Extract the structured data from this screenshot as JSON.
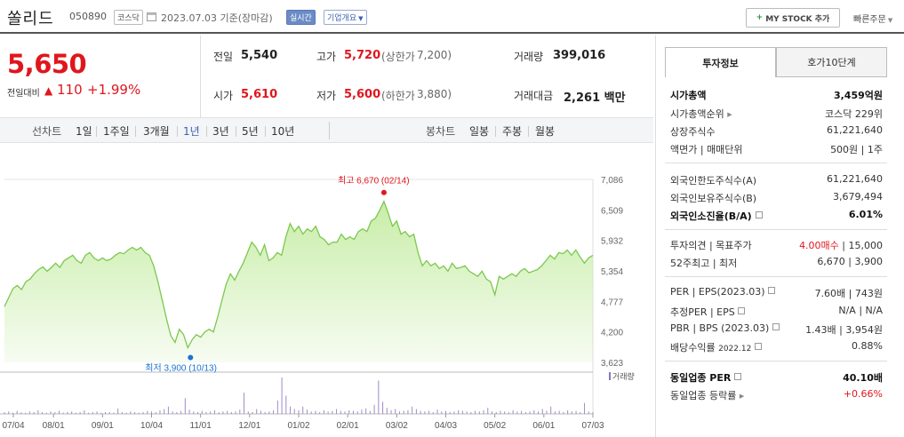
{
  "header": {
    "name": "쏠리드",
    "code": "050890",
    "market": "코스닥",
    "date": "2023.07.03",
    "basis": "기준(장마감)",
    "realtime": "실시간",
    "overview": "기업개요",
    "mystock": "MY STOCK 추가",
    "quick": "빠른주문"
  },
  "price": {
    "current": "5,650",
    "change_label": "전일대비",
    "change": "110",
    "change_pct": "+1.99%"
  },
  "quote": {
    "prev_label": "전일",
    "prev": "5,540",
    "high_label": "고가",
    "high": "5,720",
    "upper_label": "(상한가",
    "upper": "7,200)",
    "volume_label": "거래량",
    "volume": "399,016",
    "open_label": "시가",
    "open": "5,610",
    "low_label": "저가",
    "low": "5,600",
    "lower_label": "(하한가",
    "lower": "3,880)",
    "amount_label": "거래대금",
    "amount": "2,261",
    "amount_unit": "백만"
  },
  "range": {
    "line_label": "선차트",
    "line_items": [
      "1일",
      "1주일",
      "3개월",
      "1년",
      "3년",
      "5년",
      "10년"
    ],
    "selected": "1년",
    "candle_label": "봉차트",
    "candle_items": [
      "일봉",
      "주봉",
      "월봉"
    ]
  },
  "chart_data": {
    "type": "line",
    "y_ticks": [
      "7,086",
      "6,509",
      "5,932",
      "5,354",
      "4,777",
      "4,200",
      "3,623"
    ],
    "ylim": [
      3623,
      7086
    ],
    "x_ticks": [
      "07/04",
      "08/01",
      "09/01",
      "10/04",
      "11/01",
      "12/01",
      "01/02",
      "02/01",
      "03/02",
      "04/03",
      "05/02",
      "06/01",
      "07/03"
    ],
    "max_label": "최고 6,670 (02/14)",
    "min_label": "최저 3,900 (10/13)",
    "volume_label": "거래량",
    "series": [
      {
        "values": [
          4680,
          4850,
          5020,
          5080,
          5000,
          5150,
          5200,
          5300,
          5380,
          5430,
          5350,
          5420,
          5500,
          5420,
          5550,
          5600,
          5650,
          5550,
          5500,
          5650,
          5700,
          5600,
          5550,
          5600,
          5550,
          5580,
          5650,
          5700,
          5680,
          5750,
          5800,
          5750,
          5800,
          5700,
          5650,
          5450,
          5150,
          4800,
          4450,
          4130,
          4000,
          4250,
          4150,
          3900,
          4050,
          4150,
          4100,
          4200,
          4250,
          4200,
          4480,
          4800,
          5100,
          5300,
          5180,
          5350,
          5500,
          5700,
          5900,
          5800,
          5650,
          5850,
          5550,
          5600,
          5700,
          5650,
          6000,
          6250,
          6100,
          6200,
          6050,
          6150,
          6100,
          6200,
          6000,
          5950,
          5850,
          5900,
          5900,
          6050,
          5950,
          6000,
          5950,
          6100,
          6150,
          6100,
          6300,
          6350,
          6500,
          6670,
          6450,
          6200,
          6300,
          6050,
          6100,
          6000,
          6050,
          5700,
          5450,
          5550,
          5450,
          5500,
          5400,
          5450,
          5350,
          5500,
          5400,
          5420,
          5450,
          5350,
          5300,
          5250,
          5350,
          5200,
          5150,
          4900,
          5250,
          5200,
          5250,
          5300,
          5250,
          5350,
          5400,
          5320,
          5350,
          5380,
          5450,
          5550,
          5650,
          5580,
          5700,
          5680,
          5750,
          5650,
          5750,
          5620,
          5500,
          5600,
          5650
        ]
      }
    ],
    "volume_series": [
      3,
      4,
      2,
      5,
      3,
      2,
      4,
      3,
      6,
      3,
      2,
      4,
      3,
      5,
      2,
      3,
      4,
      2,
      3,
      6,
      2,
      3,
      4,
      2,
      3,
      3,
      2,
      9,
      3,
      2,
      4,
      3,
      2,
      3,
      5,
      4,
      3,
      6,
      8,
      12,
      4,
      3,
      5,
      26,
      7,
      4,
      3,
      5,
      3,
      4,
      6,
      3,
      4,
      5,
      3,
      4,
      7,
      35,
      4,
      3,
      8,
      5,
      3,
      4,
      6,
      22,
      60,
      30,
      12,
      8,
      6,
      12,
      7,
      4,
      5,
      3,
      6,
      4,
      5,
      8,
      5,
      4,
      6,
      5,
      4,
      7,
      9,
      5,
      15,
      55,
      20,
      10,
      6,
      8,
      4,
      5,
      6,
      12,
      8,
      5,
      4,
      5,
      3,
      7,
      4,
      5,
      3,
      4,
      6,
      5,
      4,
      3,
      5,
      4,
      6,
      10,
      4,
      3,
      5,
      4,
      3,
      6,
      4,
      5,
      3,
      4,
      6,
      4,
      8,
      5,
      12,
      4,
      5,
      3,
      6,
      4,
      5,
      3,
      18,
      4,
      3
    ]
  },
  "info": {
    "tab1": "투자정보",
    "tab2": "호가10단계",
    "r1": {
      "label": "시가총액",
      "value": "3,459억원"
    },
    "r2": {
      "label": "시가총액순위",
      "value": "코스닥 229위"
    },
    "r3": {
      "label": "상장주식수",
      "value": "61,221,640"
    },
    "r4": {
      "label": "액면가 | 매매단위",
      "value": "500원 | 1주"
    },
    "r5": {
      "label": "외국인한도주식수(A)",
      "value": "61,221,640"
    },
    "r6": {
      "label": "외국인보유주식수(B)",
      "value": "3,679,494"
    },
    "r7": {
      "label": "외국인소진율(B/A)",
      "value": "6.01%"
    },
    "r8": {
      "label": "투자의견 | 목표주가",
      "opinion": "4.00매수",
      "target": "| 15,000"
    },
    "r9": {
      "label": "52주최고 | 최저",
      "value": "6,670 | 3,900"
    },
    "r10": {
      "label": "PER | EPS(2023.03)",
      "value": "7.60배 | 743원"
    },
    "r11": {
      "label": "추정PER | EPS",
      "value": "N/A | N/A"
    },
    "r12": {
      "label": "PBR | BPS (2023.03)",
      "value": "1.43배 | 3,954원"
    },
    "r13": {
      "label": "배당수익률",
      "sub": "2022.12",
      "value": "0.88%"
    },
    "r14": {
      "label": "동일업종 PER",
      "value": "40.10배"
    },
    "r15": {
      "label": "동일업종 등락률",
      "value": "+0.66%"
    }
  },
  "colors": {
    "up": "#e0161d",
    "line": "#7cc84e",
    "area": "#c8eda8",
    "min": "#1a73d6"
  }
}
